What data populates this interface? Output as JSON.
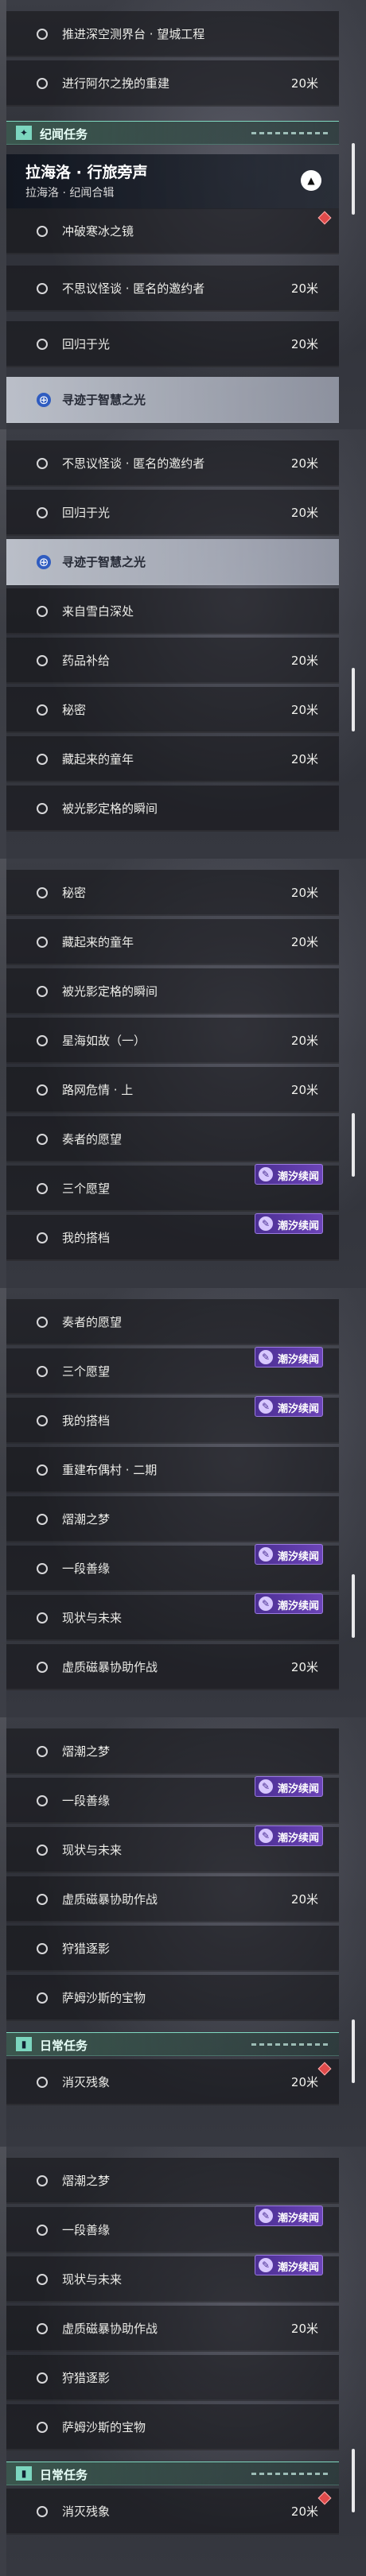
{
  "badge_text": "潮汐续闻",
  "colors": {
    "accent_teal": "#7cd6bf",
    "badge_purple": "#5a3aa6",
    "target_blue": "#2f5cc0",
    "pin_red": "#e04a4a"
  },
  "icons": {
    "row": "circle-outline-icon",
    "active": "target-icon",
    "badge": "tide-story-icon",
    "chapter_toggle": "chevron-up-icon",
    "pin": "pin-marker-icon"
  },
  "panels": [
    {
      "items": [
        {
          "type": "row",
          "label": "推进深空测界台 · 望城工程",
          "distance": ""
        },
        {
          "type": "row",
          "label": "进行阿尔之挽的重建",
          "distance": "20米"
        },
        {
          "type": "header",
          "title": "纪闻任务",
          "icon": "sparkle-icon"
        },
        {
          "type": "chapter",
          "title": "拉海洛 · 行旅旁声",
          "subtitle": "拉海洛 · 纪闻合辑"
        },
        {
          "type": "row",
          "label": "冲破寒冰之镜",
          "distance": "",
          "pin": true
        },
        {
          "type": "row",
          "label": "不思议怪谈 · 匿名的邀约者",
          "distance": "20米"
        },
        {
          "type": "row",
          "label": "回归于光",
          "distance": "20米"
        },
        {
          "type": "row",
          "label": "寻迹于智慧之光",
          "distance": "",
          "active": true
        }
      ]
    },
    {
      "items": [
        {
          "type": "row",
          "label": "不思议怪谈 · 匿名的邀约者",
          "distance": "20米"
        },
        {
          "type": "row",
          "label": "回归于光",
          "distance": "20米"
        },
        {
          "type": "row",
          "label": "寻迹于智慧之光",
          "distance": "",
          "active": true
        },
        {
          "type": "row",
          "label": "来自雪白深处",
          "distance": ""
        },
        {
          "type": "row",
          "label": "药品补给",
          "distance": "20米"
        },
        {
          "type": "row",
          "label": "秘密",
          "distance": "20米"
        },
        {
          "type": "row",
          "label": "藏起来的童年",
          "distance": "20米"
        },
        {
          "type": "row",
          "label": "被光影定格的瞬间",
          "distance": ""
        }
      ]
    },
    {
      "items": [
        {
          "type": "row",
          "label": "秘密",
          "distance": "20米"
        },
        {
          "type": "row",
          "label": "藏起来的童年",
          "distance": "20米"
        },
        {
          "type": "row",
          "label": "被光影定格的瞬间",
          "distance": ""
        },
        {
          "type": "row",
          "label": "星海如故（一）",
          "distance": "20米"
        },
        {
          "type": "row",
          "label": "路网危情 · 上",
          "distance": "20米"
        },
        {
          "type": "row",
          "label": "奏者的愿望",
          "distance": ""
        },
        {
          "type": "row",
          "label": "三个愿望",
          "distance": "",
          "badge": true
        },
        {
          "type": "row",
          "label": "我的搭档",
          "distance": "",
          "badge": true
        }
      ]
    },
    {
      "items": [
        {
          "type": "row",
          "label": "奏者的愿望",
          "distance": ""
        },
        {
          "type": "row",
          "label": "三个愿望",
          "distance": "",
          "badge": true
        },
        {
          "type": "row",
          "label": "我的搭档",
          "distance": "",
          "badge": true
        },
        {
          "type": "row",
          "label": "重建布偶村 · 二期",
          "distance": ""
        },
        {
          "type": "row",
          "label": "熠潮之梦",
          "distance": ""
        },
        {
          "type": "row",
          "label": "一段善缘",
          "distance": "",
          "badge": true
        },
        {
          "type": "row",
          "label": "现状与未来",
          "distance": "",
          "badge": true
        },
        {
          "type": "row",
          "label": "虚质磁暴协助作战",
          "distance": "20米"
        }
      ]
    },
    {
      "items": [
        {
          "type": "row",
          "label": "熠潮之梦",
          "distance": ""
        },
        {
          "type": "row",
          "label": "一段善缘",
          "distance": "",
          "badge": true
        },
        {
          "type": "row",
          "label": "现状与未来",
          "distance": "",
          "badge": true
        },
        {
          "type": "row",
          "label": "虚质磁暴协助作战",
          "distance": "20米"
        },
        {
          "type": "row",
          "label": "狩猎逐影",
          "distance": ""
        },
        {
          "type": "row",
          "label": "萨姆沙斯的宝物",
          "distance": ""
        },
        {
          "type": "header",
          "title": "日常任务",
          "icon": "book-icon"
        },
        {
          "type": "row",
          "label": "消灭残象",
          "distance": "20米",
          "pin": true
        }
      ]
    },
    {
      "items": [
        {
          "type": "row",
          "label": "熠潮之梦",
          "distance": ""
        },
        {
          "type": "row",
          "label": "一段善缘",
          "distance": "",
          "badge": true
        },
        {
          "type": "row",
          "label": "现状与未来",
          "distance": "",
          "badge": true
        },
        {
          "type": "row",
          "label": "虚质磁暴协助作战",
          "distance": "20米"
        },
        {
          "type": "row",
          "label": "狩猎逐影",
          "distance": ""
        },
        {
          "type": "row",
          "label": "萨姆沙斯的宝物",
          "distance": ""
        },
        {
          "type": "header",
          "title": "日常任务",
          "icon": "book-icon"
        },
        {
          "type": "row",
          "label": "消灭残象",
          "distance": "20米",
          "pin": true
        }
      ]
    }
  ]
}
